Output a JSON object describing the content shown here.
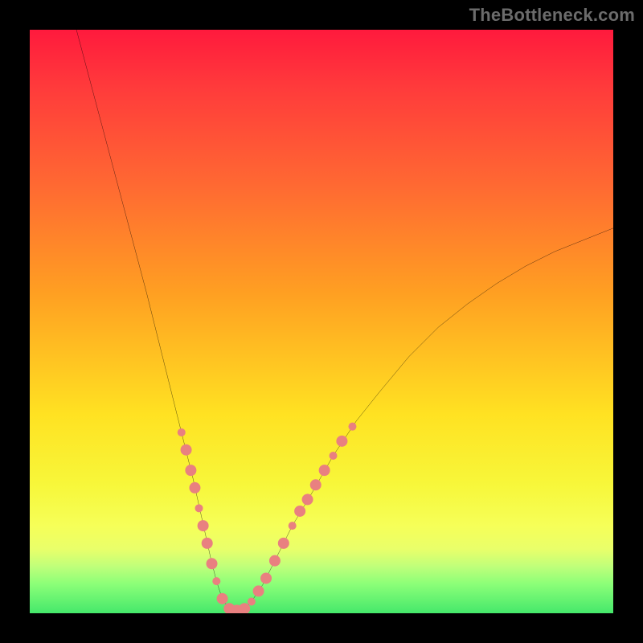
{
  "watermark": "TheBottleneck.com",
  "chart_data": {
    "type": "line",
    "title": "",
    "xlabel": "",
    "ylabel": "",
    "xlim": [
      0,
      100
    ],
    "ylim": [
      0,
      100
    ],
    "grid": false,
    "legend": false,
    "background_gradient": {
      "orientation": "vertical",
      "stops": [
        {
          "pos": 0.0,
          "color": "#ff1a3d"
        },
        {
          "pos": 0.1,
          "color": "#ff3b3b"
        },
        {
          "pos": 0.27,
          "color": "#ff6a32"
        },
        {
          "pos": 0.45,
          "color": "#ff9f22"
        },
        {
          "pos": 0.66,
          "color": "#ffe222"
        },
        {
          "pos": 0.78,
          "color": "#f7f73a"
        },
        {
          "pos": 0.85,
          "color": "#f6ff58"
        },
        {
          "pos": 0.89,
          "color": "#e9ff6a"
        },
        {
          "pos": 0.92,
          "color": "#bfff7a"
        },
        {
          "pos": 0.95,
          "color": "#8bff78"
        },
        {
          "pos": 1.0,
          "color": "#45e86b"
        }
      ]
    },
    "series": [
      {
        "name": "bottleneck-curve",
        "color": "#000000",
        "stroke_width": 2,
        "x": [
          8.0,
          10.0,
          12.0,
          14.0,
          16.0,
          18.0,
          20.0,
          22.0,
          24.0,
          26.0,
          28.0,
          30.0,
          31.0,
          32.0,
          33.0,
          34.0,
          35.0,
          36.0,
          37.0,
          38.0,
          40.0,
          42.0,
          45.0,
          48.0,
          52.0,
          56.0,
          60.0,
          65.0,
          70.0,
          75.0,
          80.0,
          85.0,
          90.0,
          95.0,
          100.0
        ],
        "y": [
          100.0,
          92.5,
          85.0,
          77.5,
          70.0,
          62.5,
          55.0,
          47.0,
          39.0,
          31.0,
          23.0,
          14.0,
          9.5,
          5.5,
          2.5,
          1.0,
          0.5,
          0.5,
          1.0,
          2.0,
          5.0,
          9.0,
          15.0,
          20.0,
          27.0,
          33.0,
          38.0,
          44.0,
          49.0,
          53.0,
          56.5,
          59.5,
          62.0,
          64.0,
          66.0
        ]
      }
    ],
    "markers": {
      "name": "highlight-dots",
      "color": "#e98080",
      "radius_major": 7,
      "radius_minor": 5,
      "points": [
        {
          "x": 26.0,
          "y": 31.0,
          "r": 5
        },
        {
          "x": 26.8,
          "y": 28.0,
          "r": 7
        },
        {
          "x": 27.6,
          "y": 24.5,
          "r": 7
        },
        {
          "x": 28.3,
          "y": 21.5,
          "r": 7
        },
        {
          "x": 29.0,
          "y": 18.0,
          "r": 5
        },
        {
          "x": 29.7,
          "y": 15.0,
          "r": 7
        },
        {
          "x": 30.4,
          "y": 12.0,
          "r": 7
        },
        {
          "x": 31.2,
          "y": 8.5,
          "r": 7
        },
        {
          "x": 32.0,
          "y": 5.5,
          "r": 5
        },
        {
          "x": 33.0,
          "y": 2.5,
          "r": 7
        },
        {
          "x": 34.2,
          "y": 0.8,
          "r": 7
        },
        {
          "x": 35.5,
          "y": 0.5,
          "r": 7
        },
        {
          "x": 36.8,
          "y": 0.8,
          "r": 7
        },
        {
          "x": 38.0,
          "y": 2.0,
          "r": 5
        },
        {
          "x": 39.2,
          "y": 3.8,
          "r": 7
        },
        {
          "x": 40.5,
          "y": 6.0,
          "r": 7
        },
        {
          "x": 42.0,
          "y": 9.0,
          "r": 7
        },
        {
          "x": 43.5,
          "y": 12.0,
          "r": 7
        },
        {
          "x": 45.0,
          "y": 15.0,
          "r": 5
        },
        {
          "x": 46.3,
          "y": 17.5,
          "r": 7
        },
        {
          "x": 47.6,
          "y": 19.5,
          "r": 7
        },
        {
          "x": 49.0,
          "y": 22.0,
          "r": 7
        },
        {
          "x": 50.5,
          "y": 24.5,
          "r": 7
        },
        {
          "x": 52.0,
          "y": 27.0,
          "r": 5
        },
        {
          "x": 53.5,
          "y": 29.5,
          "r": 7
        },
        {
          "x": 55.3,
          "y": 32.0,
          "r": 5
        }
      ]
    }
  }
}
